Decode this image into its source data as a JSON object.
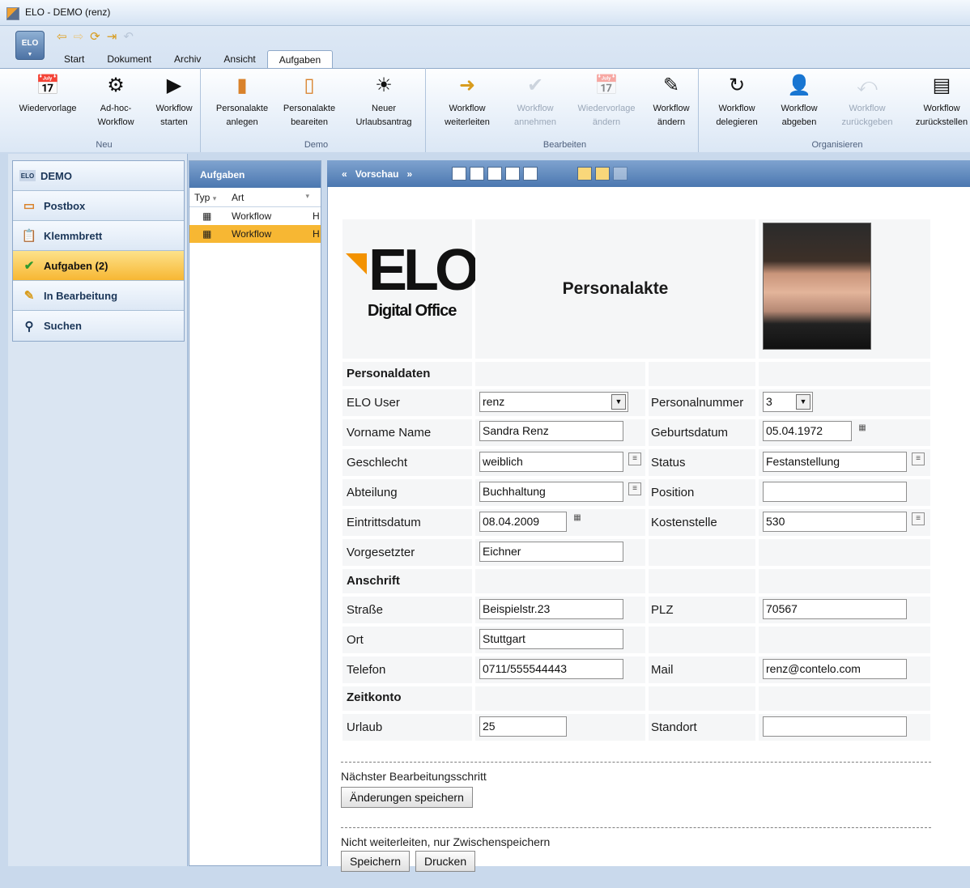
{
  "window": {
    "title": "ELO - DEMO (renz)"
  },
  "app_button": {
    "label": "ELO"
  },
  "tabs": [
    "Start",
    "Dokument",
    "Archiv",
    "Ansicht",
    "Aufgaben"
  ],
  "active_tab": "Aufgaben",
  "ribbon": {
    "groups": [
      {
        "label": "Neu",
        "buttons": [
          {
            "l1": "Wiedervorlage",
            "l2": "",
            "icon": "calendar-add-icon"
          },
          {
            "l1": "Ad-hoc-",
            "l2": "Workflow",
            "icon": "adhoc-workflow-icon"
          },
          {
            "l1": "Workflow",
            "l2": "starten",
            "icon": "workflow-start-icon"
          }
        ]
      },
      {
        "label": "Demo",
        "buttons": [
          {
            "l1": "Personalakte",
            "l2": "anlegen",
            "icon": "folder-icon"
          },
          {
            "l1": "Personalakte",
            "l2": "beareiten",
            "icon": "folder-edit-icon"
          },
          {
            "l1": "Neuer",
            "l2": "Urlaubsantrag",
            "icon": "vacation-icon"
          }
        ]
      },
      {
        "label": "Bearbeiten",
        "buttons": [
          {
            "l1": "Workflow",
            "l2": "weiterleiten",
            "icon": "workflow-forward-icon"
          },
          {
            "l1": "Workflow",
            "l2": "annehmen",
            "icon": "workflow-accept-icon",
            "disabled": true
          },
          {
            "l1": "Wiedervorlage",
            "l2": "ändern",
            "icon": "calendar-edit-icon",
            "disabled": true
          },
          {
            "l1": "Workflow",
            "l2": "ändern",
            "icon": "workflow-edit-icon"
          }
        ]
      },
      {
        "label": "Organisieren",
        "buttons": [
          {
            "l1": "Workflow",
            "l2": "delegieren",
            "icon": "workflow-delegate-icon"
          },
          {
            "l1": "Workflow",
            "l2": "abgeben",
            "icon": "workflow-handover-icon"
          },
          {
            "l1": "Workflow",
            "l2": "zurückgeben",
            "icon": "workflow-return-icon",
            "disabled": true
          },
          {
            "l1": "Workflow",
            "l2": "zurückstellen",
            "icon": "workflow-postpone-icon"
          }
        ]
      }
    ]
  },
  "nav": [
    {
      "label": "DEMO",
      "icon": "elo-icon"
    },
    {
      "label": "Postbox",
      "icon": "postbox-icon"
    },
    {
      "label": "Klemmbrett",
      "icon": "clipboard-icon"
    },
    {
      "label": "Aufgaben  (2)",
      "icon": "checkmark-icon",
      "active": true
    },
    {
      "label": "In Bearbeitung",
      "icon": "pencil-icon"
    },
    {
      "label": "Suchen",
      "icon": "search-icon"
    }
  ],
  "tasks": {
    "title": "Aufgaben",
    "col_typ": "Typ",
    "col_art": "Art",
    "rows": [
      {
        "art": "Workflow",
        "extra": "H"
      },
      {
        "art": "Workflow",
        "extra": "H",
        "selected": true
      }
    ]
  },
  "preview": {
    "title": "Vorschau",
    "prev": "«",
    "next": "»"
  },
  "form": {
    "logo": {
      "big": "ELO",
      "sub": "Digital Office"
    },
    "title": "Personalakte",
    "sec_personal": "Personaldaten",
    "sec_address": "Anschrift",
    "sec_time": "Zeitkonto",
    "labels": {
      "elo_user": "ELO User",
      "personalnummer": "Personalnummer",
      "vorname": "Vorname Name",
      "geburtsdatum": "Geburtsdatum",
      "geschlecht": "Geschlecht",
      "status": "Status",
      "abteilung": "Abteilung",
      "position": "Position",
      "eintritt": "Eintrittsdatum",
      "kostenstelle": "Kostenstelle",
      "vorgesetzter": "Vorgesetzter",
      "strasse": "Straße",
      "plz": "PLZ",
      "ort": "Ort",
      "telefon": "Telefon",
      "mail": "Mail",
      "urlaub": "Urlaub",
      "standort": "Standort"
    },
    "values": {
      "elo_user": "renz",
      "personalnummer": "3",
      "vorname": "Sandra Renz",
      "geburtsdatum": "05.04.1972",
      "geschlecht": "weiblich",
      "status": "Festanstellung",
      "abteilung": "Buchhaltung",
      "position": "",
      "eintritt": "08.04.2009",
      "kostenstelle": "530",
      "vorgesetzter": "Eichner",
      "strasse": "Beispielstr.23",
      "plz": "70567",
      "ort": "Stuttgart",
      "telefon": "0711/555544443",
      "mail": "renz@contelo.com",
      "urlaub": "25",
      "standort": ""
    },
    "next_step_label": "Nächster Bearbeitungsschritt",
    "save_changes": "Änderungen speichern",
    "save_only_label": "Nicht weiterleiten, nur Zwischenspeichern",
    "save": "Speichern",
    "print": "Drucken"
  }
}
